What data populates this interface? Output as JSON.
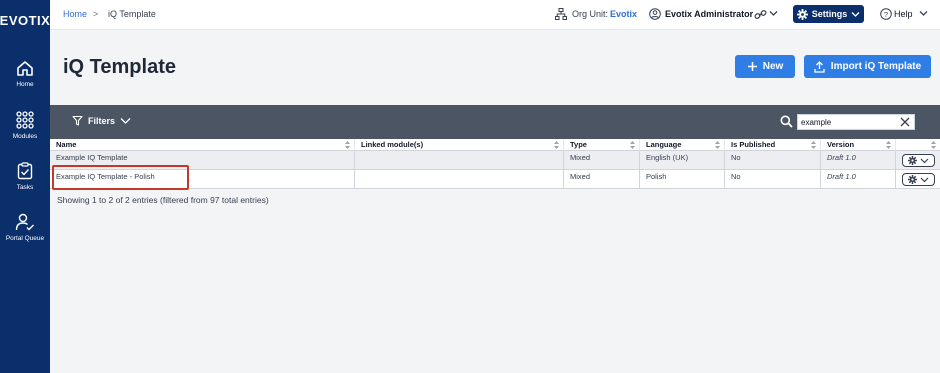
{
  "app": {
    "logo": "EVOTIX"
  },
  "sidebar": {
    "items": [
      {
        "label": "Home",
        "icon": "home-icon"
      },
      {
        "label": "Modules",
        "icon": "modules-grid-icon"
      },
      {
        "label": "Tasks",
        "icon": "clipboard-check-icon"
      },
      {
        "label": "Portal Queue",
        "icon": "user-check-icon"
      }
    ]
  },
  "topbar": {
    "breadcrumb": {
      "home": "Home",
      "separator": ">",
      "current": "iQ Template"
    },
    "org_unit_label": "Org Unit:",
    "org_unit_value": "Evotix",
    "user_name": "Evotix Administrator",
    "settings_label": "Settings",
    "help_label": "Help"
  },
  "page": {
    "title": "iQ Template",
    "new_button": "New",
    "import_button": "Import iQ Template"
  },
  "filterbar": {
    "filters_label": "Filters",
    "search_value": "example"
  },
  "table": {
    "columns": [
      "Name",
      "Linked module(s)",
      "Type",
      "Language",
      "Is Published",
      "Version"
    ],
    "rows": [
      {
        "name": "Example IQ Template",
        "linked": "",
        "type": "Mixed",
        "language": "English (UK)",
        "published": "No",
        "version": "Draft 1.0"
      },
      {
        "name": "Example IQ Template - Polish",
        "linked": "",
        "type": "Mixed",
        "language": "Polish",
        "published": "No",
        "version": "Draft 1.0"
      }
    ],
    "entries_text": "Showing 1 to 2 of 2 entries (filtered from 97 total entries)"
  },
  "colors": {
    "sidebar": "#0b2f6b",
    "primary_button": "#2f7ee6",
    "filterbar": "#4b5563",
    "highlight": "#c0392b"
  }
}
